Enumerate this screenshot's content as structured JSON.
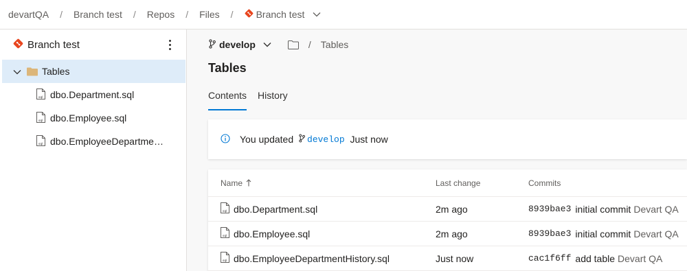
{
  "breadcrumb": {
    "org": "devartQA",
    "project": "Branch test",
    "section": "Repos",
    "subsection": "Files",
    "repo": "Branch test"
  },
  "sidebar": {
    "repo_name": "Branch test",
    "folder": "Tables",
    "files": [
      "dbo.Department.sql",
      "dbo.Employee.sql",
      "dbo.EmployeeDepartmen..."
    ]
  },
  "path": {
    "branch": "develop",
    "separator": "/",
    "current": "Tables"
  },
  "page": {
    "title": "Tables"
  },
  "tabs": [
    "Contents",
    "History"
  ],
  "info": {
    "prefix": "You updated",
    "branch": "develop",
    "suffix": "Just now"
  },
  "table": {
    "headers": {
      "name": "Name",
      "last_change": "Last change",
      "commits": "Commits"
    },
    "rows": [
      {
        "name": "dbo.Department.sql",
        "last_change": "2m ago",
        "commit_id": "8939bae3",
        "message": "initial commit",
        "author": "Devart QA"
      },
      {
        "name": "dbo.Employee.sql",
        "last_change": "2m ago",
        "commit_id": "8939bae3",
        "message": "initial commit",
        "author": "Devart QA"
      },
      {
        "name": "dbo.EmployeeDepartmentHistory.sql",
        "last_change": "Just now",
        "commit_id": "cac1f6ff",
        "message": "add table",
        "author": "Devart QA"
      }
    ]
  },
  "colors": {
    "accent": "#0078d4",
    "git_red": "#e8461f",
    "folder": "#dcb67a",
    "selected": "#deecf9"
  },
  "icons": [
    "git-repo-icon",
    "chevron-down-icon",
    "more-icon",
    "folder-icon",
    "sql-file-icon",
    "branch-icon",
    "info-icon",
    "sort-up-icon"
  ]
}
